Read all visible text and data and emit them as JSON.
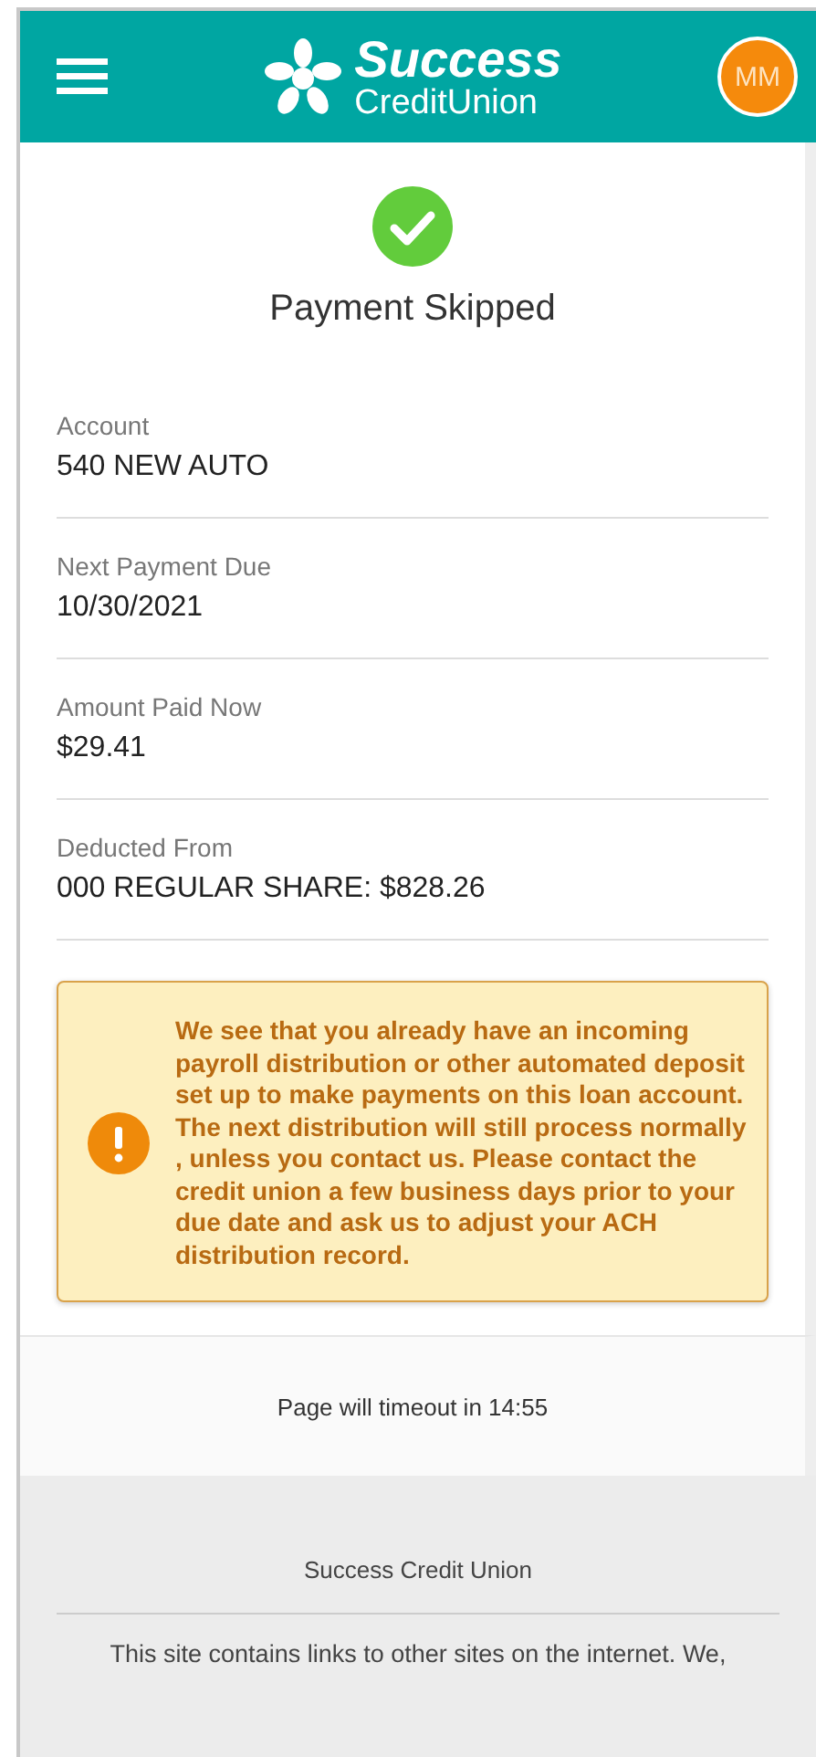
{
  "header": {
    "logo": {
      "line1": "Success",
      "line2": "CreditUnion"
    },
    "avatar": {
      "initials": "MM"
    }
  },
  "status": {
    "kind": "success",
    "title": "Payment Skipped"
  },
  "fields": [
    {
      "label": "Account",
      "value": "540 NEW AUTO"
    },
    {
      "label": "Next Payment Due",
      "value": "10/30/2021"
    },
    {
      "label": "Amount Paid Now",
      "value": "$29.41"
    },
    {
      "label": "Deducted From",
      "value": "000 REGULAR SHARE: $828.26"
    }
  ],
  "alert": {
    "kind": "warning",
    "text": "We see that you already have an incoming payroll distribution or other automated deposit set up to make payments on this loan account. The next distribution will still process normally , unless you contact us. Please contact the credit union a few business days prior to your due date and ask us to adjust your ACH distribution record."
  },
  "timeout": "Page will timeout in 14:55",
  "footer": {
    "title": "Success Credit Union",
    "disclaimer": "This site contains links to other sites on the internet. We,"
  }
}
